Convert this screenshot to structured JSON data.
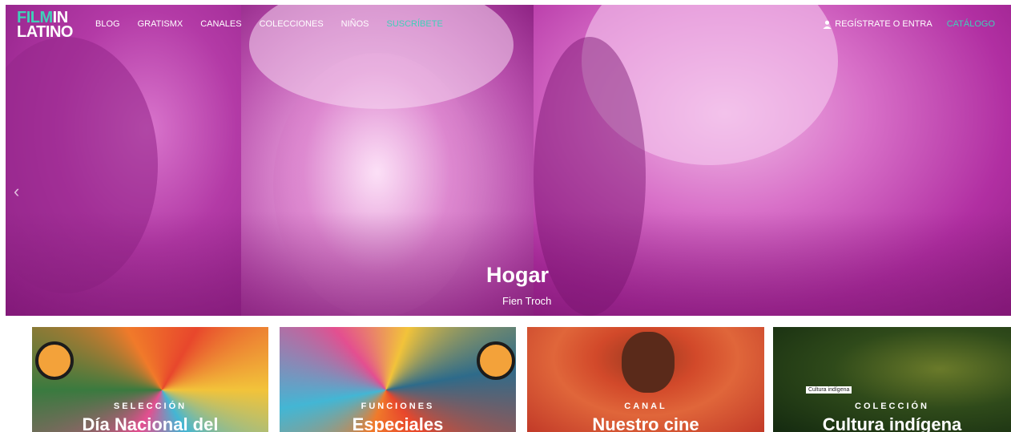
{
  "nav": {
    "logo_line1_a": "FILM",
    "logo_line1_b": "IN",
    "logo_line2": "LATINO",
    "links": [
      "BLOG",
      "GRATISMX",
      "CANALES",
      "COLECCIONES",
      "NIÑOS",
      "SUSCRÍBETE"
    ],
    "login_label": "REGÍSTRATE O ENTRA",
    "catalog_label": "CATÁLOGO"
  },
  "hero": {
    "title": "Hogar",
    "subtitle": "Fien Troch",
    "prev_arrow": "‹"
  },
  "cards": [
    {
      "kicker": "SELECCIÓN",
      "title": "Día Nacional del"
    },
    {
      "kicker": "FUNCIONES",
      "title": "Especiales"
    },
    {
      "kicker": "CANAL",
      "title": "Nuestro cine"
    },
    {
      "kicker": "COLECCIÓN",
      "title": "Cultura indígena",
      "tag": "Cultura indígena"
    }
  ],
  "colors": {
    "accent": "#3fd0b8",
    "hero_tint": "#c02fae"
  }
}
